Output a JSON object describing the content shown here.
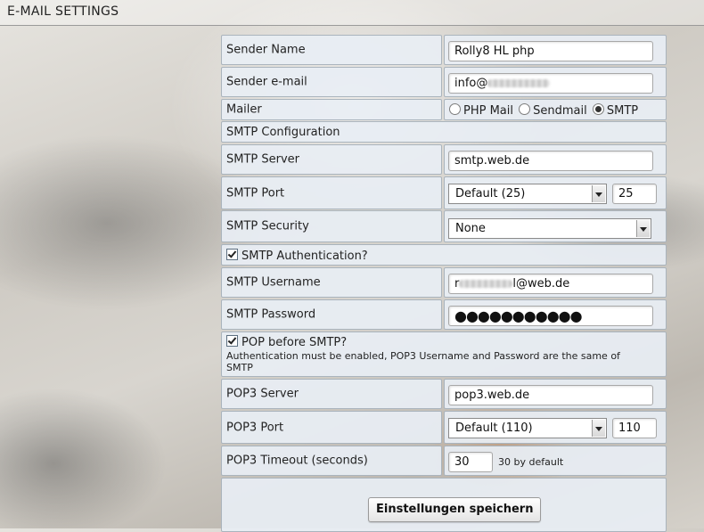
{
  "header": {
    "title": "E-MAIL SETTINGS"
  },
  "sender_name": {
    "label": "Sender Name",
    "value": "Rolly8 HL php"
  },
  "sender_email": {
    "label": "Sender e-mail",
    "value": "info@"
  },
  "mailer": {
    "label": "Mailer",
    "options": [
      "PHP Mail",
      "Sendmail",
      "SMTP"
    ],
    "selected": "SMTP"
  },
  "smtp_config": {
    "label": "SMTP Configuration"
  },
  "smtp_server": {
    "label": "SMTP Server",
    "value": "smtp.web.de"
  },
  "smtp_port": {
    "label": "SMTP Port",
    "selected": "Default (25)",
    "value": "25"
  },
  "smtp_security": {
    "label": "SMTP Security",
    "selected": "None"
  },
  "smtp_auth": {
    "label": "SMTP Authentication?",
    "checked": true
  },
  "smtp_username": {
    "label": "SMTP Username",
    "prefix": "r",
    "suffix": "l@web.de"
  },
  "smtp_password": {
    "label": "SMTP Password",
    "mask": "●●●●●●●●●●●"
  },
  "pop_before_smtp": {
    "label": "POP before SMTP?",
    "checked": true,
    "note": "Authentication must be enabled, POP3 Username and Password are the same of SMTP"
  },
  "pop3_server": {
    "label": "POP3 Server",
    "value": "pop3.web.de"
  },
  "pop3_port": {
    "label": "POP3 Port",
    "selected": "Default (110)",
    "value": "110"
  },
  "pop3_timeout": {
    "label": "POP3 Timeout (seconds)",
    "value": "30",
    "hint": "30 by default"
  },
  "save_button": {
    "label": "Einstellungen speichern"
  }
}
